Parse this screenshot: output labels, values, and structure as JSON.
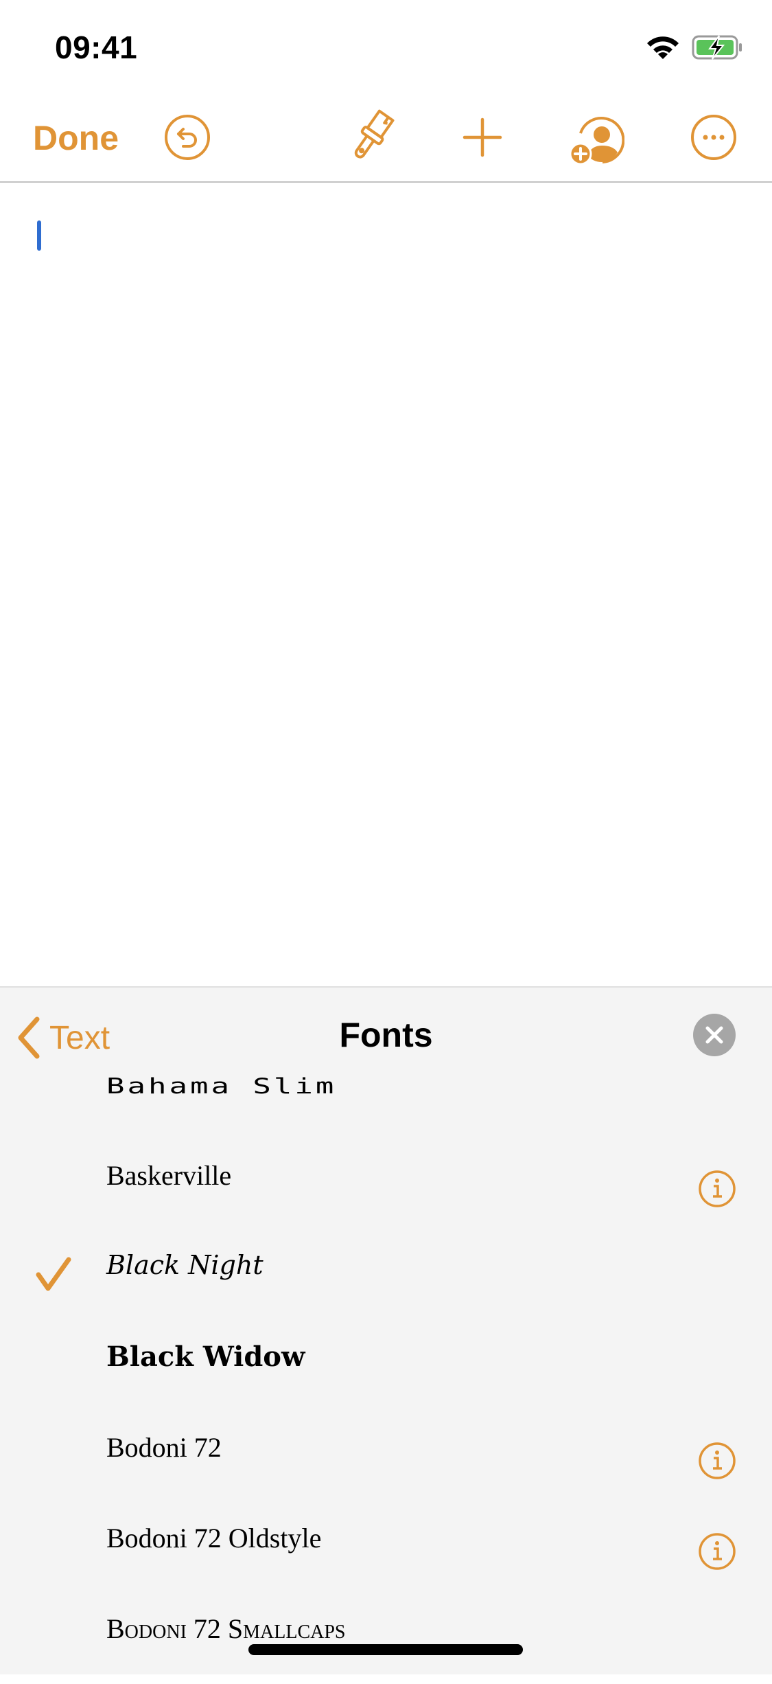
{
  "status_bar": {
    "time": "09:41",
    "wifi_icon": "wifi-icon",
    "battery_icon": "battery-charging-icon",
    "battery_color": "#5ac35a"
  },
  "toolbar": {
    "done_label": "Done",
    "icons": [
      "undo-icon",
      "paintbrush-icon",
      "plus-icon",
      "add-person-icon",
      "more-icon"
    ],
    "accent_color": "#e09436"
  },
  "document": {
    "caret_color": "#2f6dd0",
    "content": ""
  },
  "fonts_panel": {
    "back_label": "Text",
    "title": "Fonts",
    "close_icon": "close-icon",
    "items": [
      {
        "name": "Bahama Slim",
        "selected": false,
        "has_info": false
      },
      {
        "name": "Baskerville",
        "selected": false,
        "has_info": true
      },
      {
        "name": "Black Night",
        "selected": true,
        "has_info": false
      },
      {
        "name": "Black Widow",
        "selected": false,
        "has_info": false
      },
      {
        "name": "Bodoni 72",
        "selected": false,
        "has_info": true
      },
      {
        "name": "Bodoni 72 Oldstyle",
        "selected": false,
        "has_info": true
      },
      {
        "name": "Bodoni 72 Smallcaps",
        "selected": false,
        "has_info": false
      }
    ]
  }
}
